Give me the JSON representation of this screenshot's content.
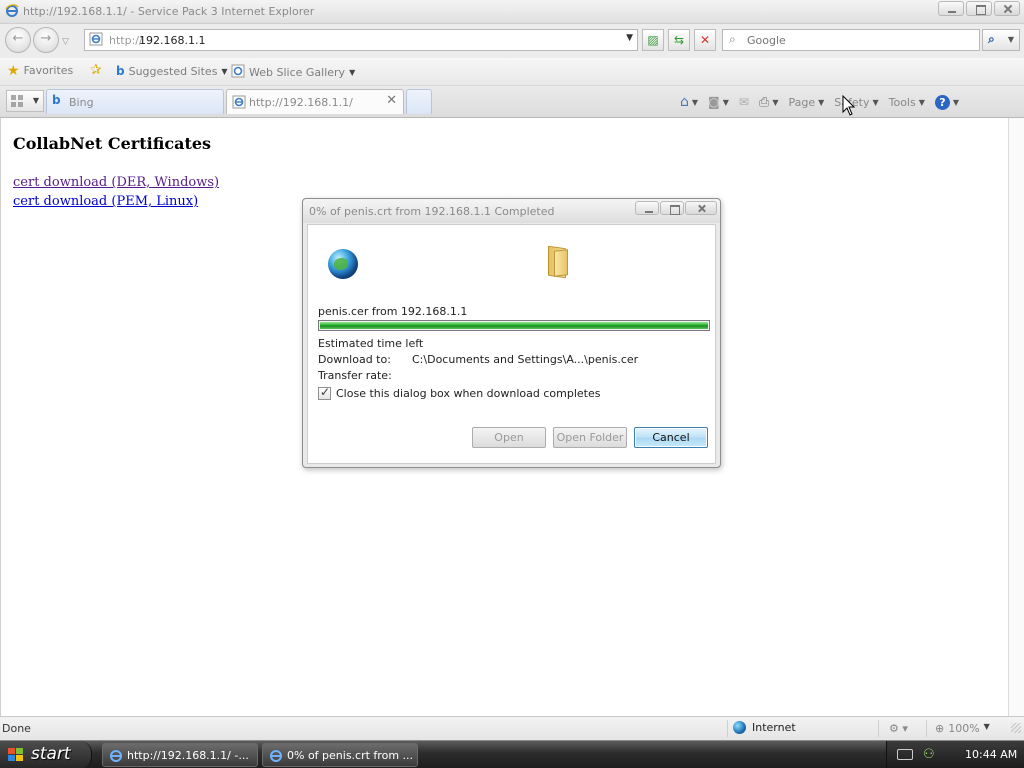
{
  "window": {
    "title": "http://192.168.1.1/ - Service Pack 3 Internet Explorer"
  },
  "address_bar": {
    "url_scheme": "http://",
    "url_host": "192.168.1.1"
  },
  "search": {
    "placeholder": "Google"
  },
  "favorites_bar": {
    "favorites_label": "Favorites",
    "suggested_sites_label": "Suggested Sites",
    "web_slice_label": "Web Slice Gallery"
  },
  "tabs": [
    {
      "label": "Bing",
      "active": false
    },
    {
      "label": "http://192.168.1.1/",
      "active": true
    }
  ],
  "command_bar": {
    "page_label": "Page",
    "safety_label": "Safety",
    "tools_label": "Tools",
    "help_glyph": "?"
  },
  "page": {
    "heading": "CollabNet Certificates",
    "links": [
      {
        "label": "cert download (DER, Windows)",
        "visited": true
      },
      {
        "label": "cert download (PEM, Linux)",
        "visited": false
      }
    ]
  },
  "dialog": {
    "title": "0% of penis.crt from 192.168.1.1 Completed",
    "file_line": "penis.cer from 192.168.1.1",
    "progress_fraction": 1.0,
    "estimated_time_label": "Estimated time left",
    "download_to_label": "Download to:",
    "download_to_value": "C:\\Documents and Settings\\A...\\penis.cer",
    "transfer_rate_label": "Transfer rate:",
    "close_when_done_label": "Close this dialog box when download completes",
    "close_when_done_checked": true,
    "buttons": {
      "open": "Open",
      "open_folder": "Open Folder",
      "cancel": "Cancel"
    }
  },
  "status_bar": {
    "status_text": "Done",
    "zone": "Internet",
    "zoom": "100%"
  },
  "taskbar": {
    "start_label": "start",
    "items": [
      {
        "label": "http://192.168.1.1/ -..."
      },
      {
        "label": "0% of penis.crt from ..."
      }
    ],
    "clock": "10:44 AM"
  },
  "colors": {
    "visited_link": "#551a8b",
    "link": "#0000cc",
    "progress_green": "#27b12b",
    "cancel_button_blue": "#a9d9f3"
  }
}
